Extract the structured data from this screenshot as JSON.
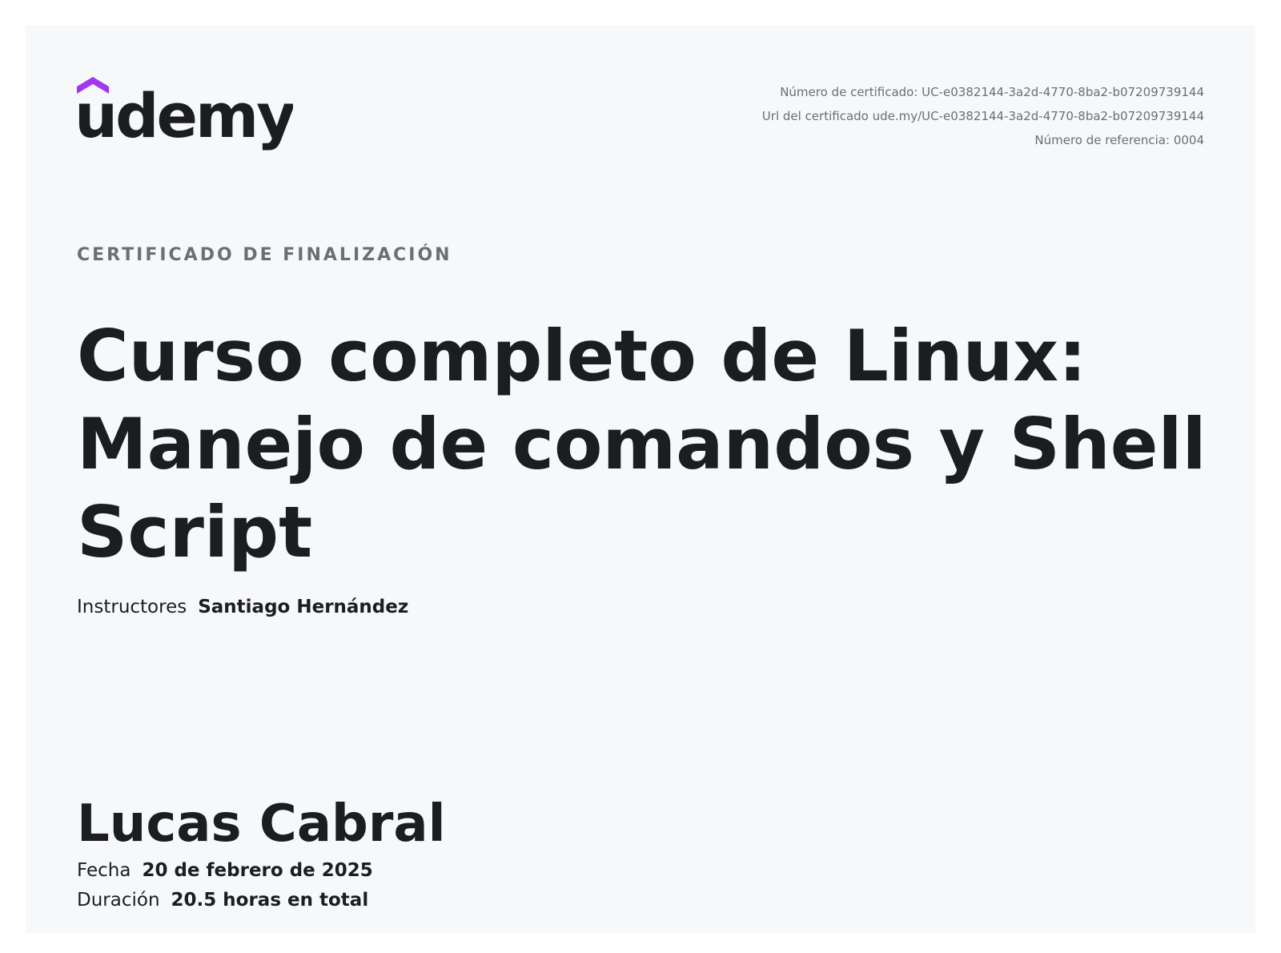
{
  "brand": {
    "logo_text": "udemy",
    "logo_color": "#1c1d1f",
    "accent_color": "#a435f0"
  },
  "certificate_meta": {
    "certificate_number": "Número de certificado: UC-e0382144-3a2d-4770-8ba2-b07209739144",
    "certificate_url": "Url del certificado ude.my/UC-e0382144-3a2d-4770-8ba2-b07209739144",
    "reference_number": "Número de referencia: 0004"
  },
  "overline": "CERTIFICADO DE FINALIZACIÓN",
  "course": {
    "title": "Curso completo de Linux: Manejo de comandos y Shell Script"
  },
  "instructors": {
    "label": "Instructores",
    "name": "Santiago Hernández"
  },
  "student": {
    "name": "Lucas Cabral"
  },
  "date": {
    "label": "Fecha",
    "value": "20 de febrero de 2025"
  },
  "duration": {
    "label": "Duración",
    "value": "20.5 horas en total"
  }
}
